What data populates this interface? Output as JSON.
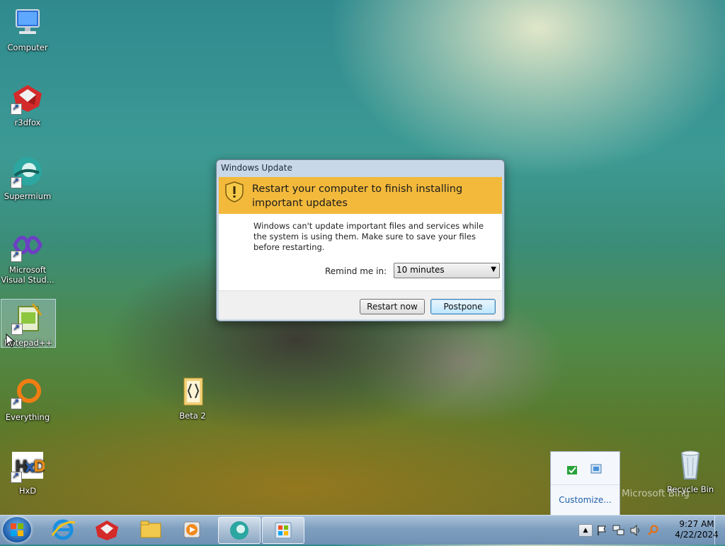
{
  "desktop": {
    "icons": [
      {
        "label": "Computer"
      },
      {
        "label": "r3dfox"
      },
      {
        "label": "Supermium"
      },
      {
        "label": "Microsoft Visual Stud..."
      },
      {
        "label": "Notepad++"
      },
      {
        "label": "Everything"
      },
      {
        "label": "HxD"
      },
      {
        "label": "Beta 2"
      },
      {
        "label": "Recycle Bin"
      }
    ],
    "watermark": "Microsoft Bing"
  },
  "dialog": {
    "title": "Windows Update",
    "headline": "Restart your computer to finish installing important updates",
    "description": "Windows can't update important files and services while the system is using them. Make sure to save your files before restarting.",
    "remind_label": "Remind me in:",
    "remind_value": "10 minutes",
    "restart_label": "Restart now",
    "postpone_label": "Postpone"
  },
  "tray_popup": {
    "customize_label": "Customize..."
  },
  "taskbar": {
    "time": "9:27 AM",
    "date": "4/22/2024"
  }
}
